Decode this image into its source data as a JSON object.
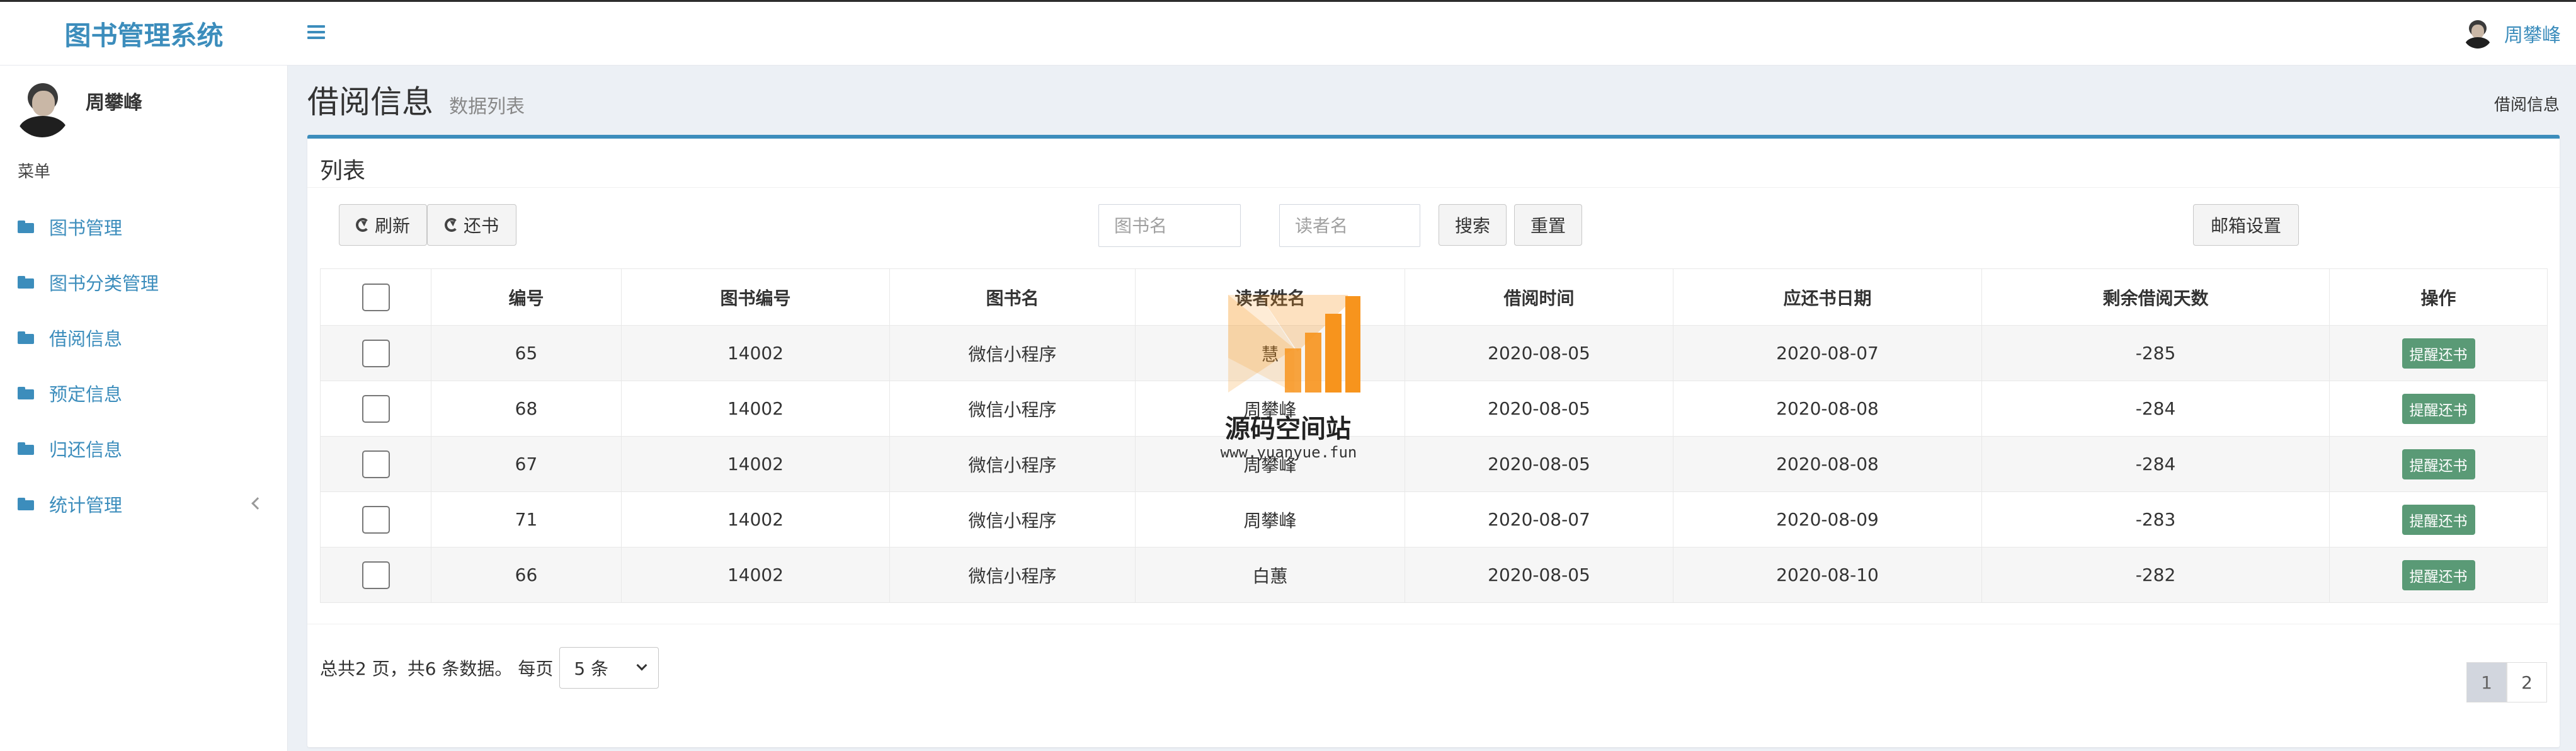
{
  "app": {
    "title": "图书管理系统"
  },
  "header": {
    "user_name": "周攀峰"
  },
  "sidebar": {
    "user_name": "周攀峰",
    "menu_header": "菜单",
    "items": [
      {
        "label": "图书管理"
      },
      {
        "label": "图书分类管理"
      },
      {
        "label": "借阅信息"
      },
      {
        "label": "预定信息"
      },
      {
        "label": "归还信息"
      },
      {
        "label": "统计管理"
      }
    ]
  },
  "page": {
    "title": "借阅信息",
    "subtitle": "数据列表",
    "breadcrumb": "借阅信息"
  },
  "box": {
    "title": "列表"
  },
  "toolbar": {
    "refresh_label": "刷新",
    "return_label": "还书",
    "book_name_placeholder": "图书名",
    "reader_name_placeholder": "读者名",
    "search_label": "搜索",
    "reset_label": "重置",
    "email_settings_label": "邮箱设置"
  },
  "table": {
    "columns": [
      "编号",
      "图书编号",
      "图书名",
      "读者姓名",
      "借阅时间",
      "应还书日期",
      "剩余借阅天数",
      "操作"
    ],
    "rows": [
      {
        "id": "65",
        "book_no": "14002",
        "book_name": "微信小程序",
        "reader": "慧",
        "borrow_date": "2020-08-05",
        "due_date": "2020-08-07",
        "days_left": "-285",
        "action": "提醒还书"
      },
      {
        "id": "68",
        "book_no": "14002",
        "book_name": "微信小程序",
        "reader": "周攀峰",
        "borrow_date": "2020-08-05",
        "due_date": "2020-08-08",
        "days_left": "-284",
        "action": "提醒还书"
      },
      {
        "id": "67",
        "book_no": "14002",
        "book_name": "微信小程序",
        "reader": "周攀峰",
        "borrow_date": "2020-08-05",
        "due_date": "2020-08-08",
        "days_left": "-284",
        "action": "提醒还书"
      },
      {
        "id": "71",
        "book_no": "14002",
        "book_name": "微信小程序",
        "reader": "周攀峰",
        "borrow_date": "2020-08-07",
        "due_date": "2020-08-09",
        "days_left": "-283",
        "action": "提醒还书"
      },
      {
        "id": "66",
        "book_no": "14002",
        "book_name": "微信小程序",
        "reader": "白蕙",
        "borrow_date": "2020-08-05",
        "due_date": "2020-08-10",
        "days_left": "-282",
        "action": "提醒还书"
      }
    ]
  },
  "pagination": {
    "info": "总共2 页，共6 条数据。 每页",
    "page_size": "5 条",
    "pages": [
      "1",
      "2"
    ],
    "current": "1"
  },
  "watermark": {
    "text": "源码空间站",
    "url": "www.yuanyue.fun"
  },
  "colors": {
    "brand": "#3c8dbc",
    "remind_button": "#5a9a76",
    "watermark_orange": "#f7941d"
  }
}
